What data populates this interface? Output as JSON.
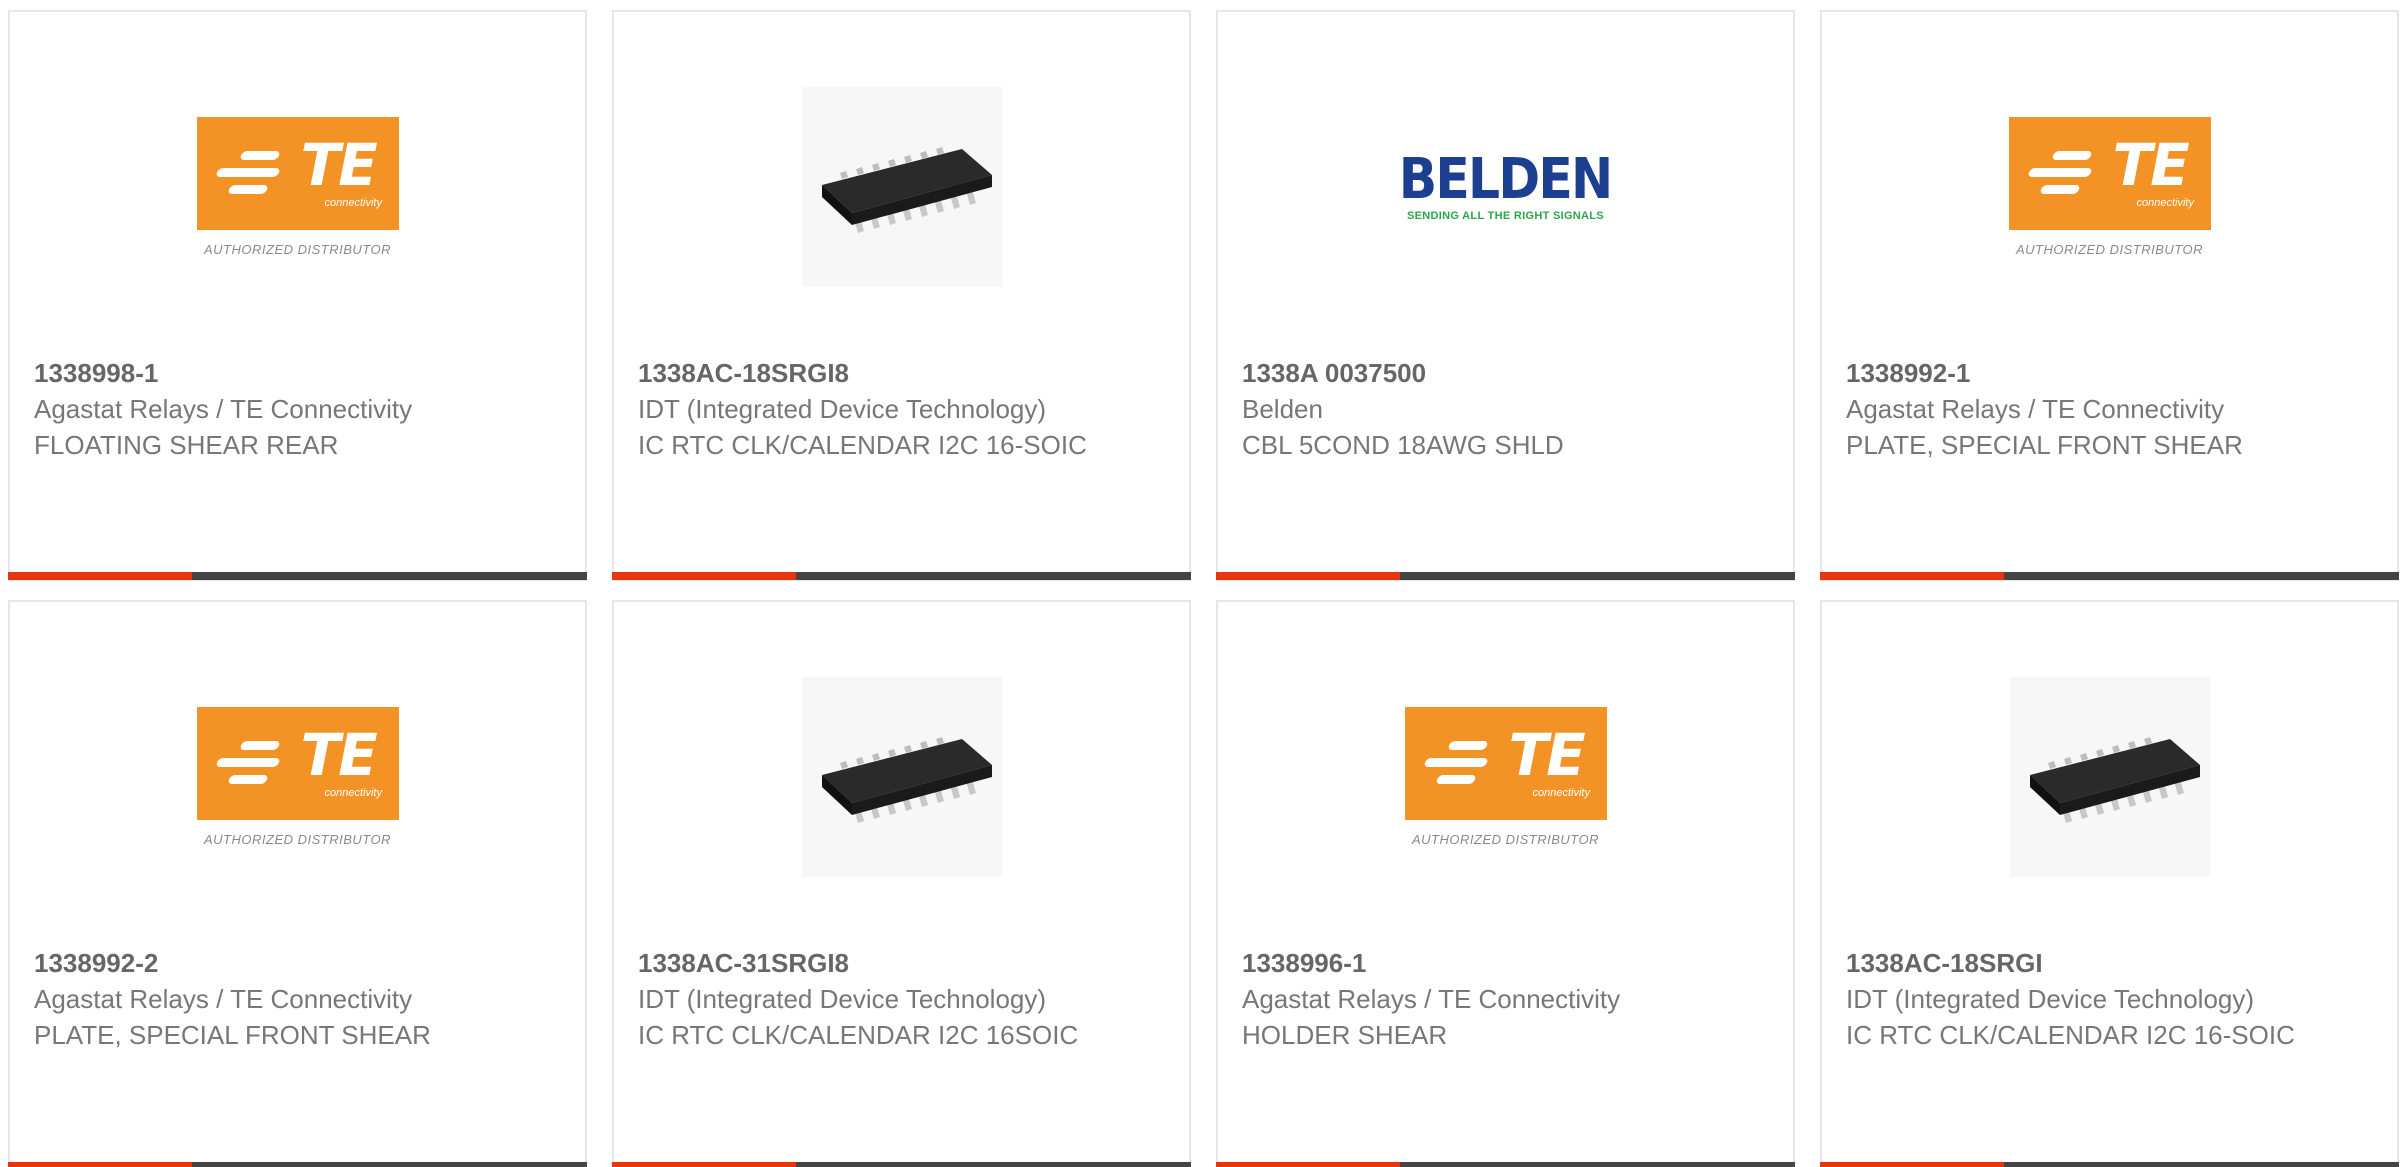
{
  "products": [
    {
      "part": "1338998-1",
      "manufacturer": "Agastat Relays / TE Connectivity",
      "description": "FLOATING SHEAR REAR",
      "image": "te-logo"
    },
    {
      "part": "1338AC-18SRGI8",
      "manufacturer": "IDT (Integrated Device Technology)",
      "description": "IC RTC CLK/CALENDAR I2C 16-SOIC",
      "image": "soic-chip"
    },
    {
      "part": "1338A 0037500",
      "manufacturer": "Belden",
      "description": "CBL 5COND 18AWG SHLD",
      "image": "belden-logo"
    },
    {
      "part": "1338992-1",
      "manufacturer": "Agastat Relays / TE Connectivity",
      "description": "PLATE, SPECIAL FRONT SHEAR",
      "image": "te-logo"
    },
    {
      "part": "1338992-2",
      "manufacturer": "Agastat Relays / TE Connectivity",
      "description": "PLATE, SPECIAL FRONT SHEAR",
      "image": "te-logo"
    },
    {
      "part": "1338AC-31SRGI8",
      "manufacturer": "IDT (Integrated Device Technology)",
      "description": "IC RTC CLK/CALENDAR I2C 16SOIC",
      "image": "soic-chip"
    },
    {
      "part": "1338996-1",
      "manufacturer": "Agastat Relays / TE Connectivity",
      "description": "HOLDER SHEAR",
      "image": "te-logo"
    },
    {
      "part": "1338AC-18SRGI",
      "manufacturer": "IDT (Integrated Device Technology)",
      "description": "IC RTC CLK/CALENDAR I2C 16-SOIC",
      "image": "soic-chip"
    }
  ],
  "logos": {
    "te_letters": "TE",
    "te_sub": "connectivity",
    "te_authorized": "AUTHORIZED DISTRIBUTOR",
    "belden_word": "BELDEN",
    "belden_tagline": "SENDING ALL THE RIGHT SIGNALS"
  },
  "colors": {
    "accent": "#e8350b",
    "bar": "#444444",
    "te_orange": "#f39325",
    "belden_blue": "#1d3f8f",
    "belden_green": "#2aa64a"
  }
}
